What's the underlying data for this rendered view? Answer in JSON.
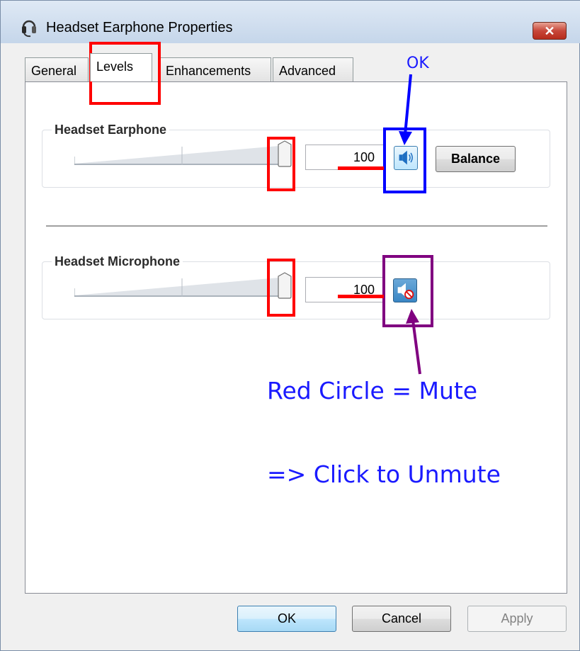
{
  "window": {
    "title": "Headset Earphone Properties",
    "close_label": "✕",
    "icon": "headset-icon"
  },
  "tabs": [
    {
      "label": "General",
      "active": false
    },
    {
      "label": "Levels",
      "active": true
    },
    {
      "label": "Enhancements",
      "active": false
    },
    {
      "label": "Advanced",
      "active": false
    }
  ],
  "earphone": {
    "group_label": "Headset Earphone",
    "value": "100",
    "level": 1.0,
    "speaker_icon": "speaker-icon",
    "muted": false,
    "balance_label": "Balance"
  },
  "microphone": {
    "group_label": "Headset Microphone",
    "value": "100",
    "level": 1.0,
    "speaker_icon": "speaker-muted-icon",
    "muted": true
  },
  "annotations": {
    "ok_label": "OK",
    "mute_note": "Red Circle = Mute",
    "unmute_note": "=> Click to Unmute",
    "colors": {
      "red": "#ff0000",
      "blue": "#0000ff",
      "purple": "#800080",
      "text_blue": "#1a1aff"
    }
  },
  "buttons": {
    "ok": "OK",
    "cancel": "Cancel",
    "apply": "Apply"
  }
}
